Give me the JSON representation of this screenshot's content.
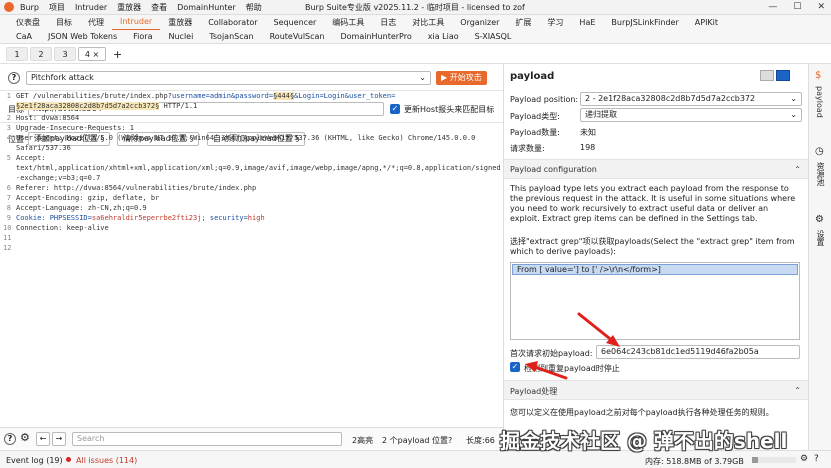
{
  "titlebar": {
    "menu": [
      "Burp",
      "项目",
      "Intruder",
      "重放器",
      "查看",
      "DomainHunter",
      "帮助"
    ],
    "window_title": "Burp Suite专业版  v2025.11.2 - 临时项目 - licensed to zof"
  },
  "tabs_row1": [
    "仪表盘",
    "目标",
    "代理",
    "Intruder",
    "重放器",
    "Collaborator",
    "Sequencer",
    "编码工具",
    "日志",
    "对比工具",
    "Organizer",
    "扩展",
    "学习",
    "HaE",
    "BurpJSLinkFinder",
    "APIKit"
  ],
  "tabs_row1_active": "Intruder",
  "tabs_row2": [
    "CaA",
    "JSON Web Tokens",
    "Fiora",
    "Nuclei",
    "TsojanScan",
    "RouteVulScan",
    "DomainHunterPro",
    "xia Liao",
    "S-XIASQL"
  ],
  "tabs_row3": [
    "1",
    "2",
    "3",
    "4 ×"
  ],
  "attack": {
    "type": "Pitchfork attack",
    "start_label": "开始攻击"
  },
  "target": {
    "label": "目标",
    "value": "http://dvwa:8564",
    "update_host_label": "更新Host报头来匹配目标"
  },
  "positions": {
    "label": "位置",
    "add_label": "添加payload位置 §",
    "clear_label": "清除payload位置 §",
    "auto_label": "自动添加payload位置 §"
  },
  "request": {
    "line1_a": "GET /vulnerabilities/brute/index.php?",
    "line1_b": "username=admin&password=",
    "line1_c": "§444§",
    "line1_d": "&Login=Login&user_token=",
    "line1_e": "§2e1f28aca32808c2d8b7d5d7a2ccb372§",
    "line1_f": " HTTP/1.1",
    "line2": "Host: dvwa:8564",
    "line3": "Upgrade-Insecure-Requests: 1",
    "line4a": "User-Agent: Mozilla/5.0 (Windows NT 10.0; Win64; x64) AppleWebKit/537.36 (KHTML, like Gecko) Chrome/145.0.0.0",
    "line4b": "Safari/537.36",
    "line5a": "Accept:",
    "line5b": "text/html,application/xhtml+xml,application/xml;q=0.9,image/avif,image/webp,image/apng,*/*;q=0.8,application/signed",
    "line5c": "-exchange;v=b3;q=0.7",
    "line6": "Referer: http://dvwa:8564/vulnerabilities/brute/index.php",
    "line7": "Accept-Encoding: gzip, deflate, br",
    "line8": "Accept-Language: zh-CN,zh;q=0.9",
    "line9_a": "Cookie: PHPSESSID=",
    "line9_b": "sa6ehraldir5eperrbe2fti23j",
    "line9_c": "; security=",
    "line9_d": "high",
    "line10": "Connection: keep-alive",
    "line_numbers": [
      "1",
      "2",
      "3",
      "4",
      "",
      "5",
      "",
      "",
      "6",
      "7",
      "8",
      "9",
      "10",
      "11",
      "12"
    ]
  },
  "bottombar": {
    "search_placeholder": "Search",
    "highlights": "2高亮",
    "payload_positions": "2 个payload 位置?",
    "length": "长度:66"
  },
  "statusbar": {
    "event_log": "Event log (19)",
    "all_issues": "All issues (114)",
    "memory": "内存: 518.8MB of 3.79GB"
  },
  "right": {
    "title": "payload",
    "position_label": "Payload position:",
    "position_value": "2 - 2e1f28aca32808c2d8b7d5d7a2ccb372",
    "type_label": "Payload类型:",
    "type_value": "递归提取",
    "count_label": "Payload数量:",
    "count_value": "未知",
    "requests_label": "请求数量:",
    "requests_value": "198",
    "config_title": "Payload configuration",
    "config_desc": "This payload type lets you extract each payload from the response to the previous request in the attack. It is useful in some situations where you need to work recursively to extract useful data or deliver an exploit. Extract grep items can be defined in the Settings tab.",
    "grep_desc": "选择\"extract grep\"项以获取payloads(Select the \"extract grep\" item from which to derive payloads):",
    "grep_item": "From [ value='] to [' />\\r\\n</form>]",
    "initial_label": "首次请求初始payload:",
    "initial_value": "6e064c243cb81dc1ed5119d46fa2b05a",
    "stop_label": "检测到重复payload时停止",
    "processing_title": "Payload处理",
    "processing_desc": "您可以定义在使用payload之前对每个payload执行各种处理任务的规则。"
  },
  "side": {
    "payload": "payload",
    "resource_pool": "资源池",
    "settings": "设置"
  },
  "watermark": "掘金技术社区 @ 弹不出的shell",
  "colors": {
    "accent": "#e8692b",
    "blue": "#1a64c8",
    "arrow": "#e0201a"
  }
}
